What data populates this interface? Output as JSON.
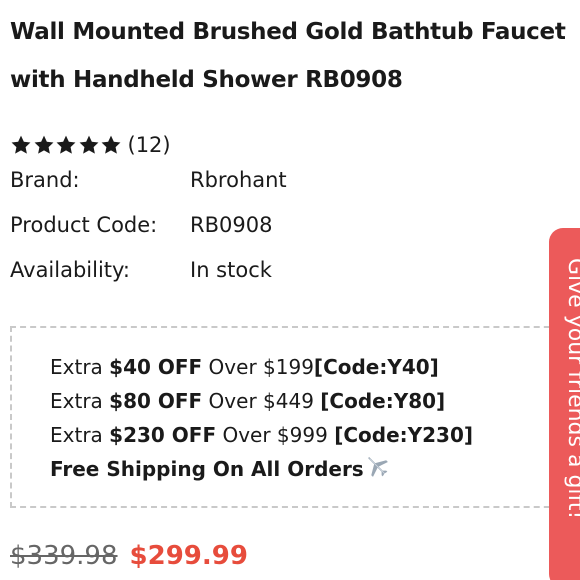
{
  "product": {
    "title_line1": "Wall Mounted Brushed Gold Bathtub Faucet",
    "title_line2": "with Handheld Shower RB0908",
    "rating_stars": 5,
    "review_count": "(12)"
  },
  "specs": {
    "brand_label": "Brand:",
    "brand_value": "Rbrohant",
    "code_label": "Product Code:",
    "code_value": "RB0908",
    "availability_label": "Availability:",
    "availability_value": "In stock"
  },
  "promotions": [
    {
      "prefix": "Extra ",
      "amount": "$40 OFF",
      "condition": " Over $199",
      "code": "[Code:Y40]"
    },
    {
      "prefix": "Extra ",
      "amount": "$80 OFF",
      "condition": " Over $449 ",
      "code": "[Code:Y80]"
    },
    {
      "prefix": "Extra ",
      "amount": "$230 OFF",
      "condition": " Over $999 ",
      "code": "[Code:Y230]"
    }
  ],
  "shipping": {
    "text": "Free Shipping On All Orders",
    "icon": "airplane-icon"
  },
  "pricing": {
    "original_price": "$339.98",
    "sale_price": "$299.99"
  },
  "gift_tab": {
    "label": "Give your friends a gift!"
  },
  "colors": {
    "sale_price": "#e74c3c",
    "gift_tab_bg": "#ec5a5a",
    "star": "#1a1a1a",
    "border_dashed": "#c9c9c9"
  }
}
